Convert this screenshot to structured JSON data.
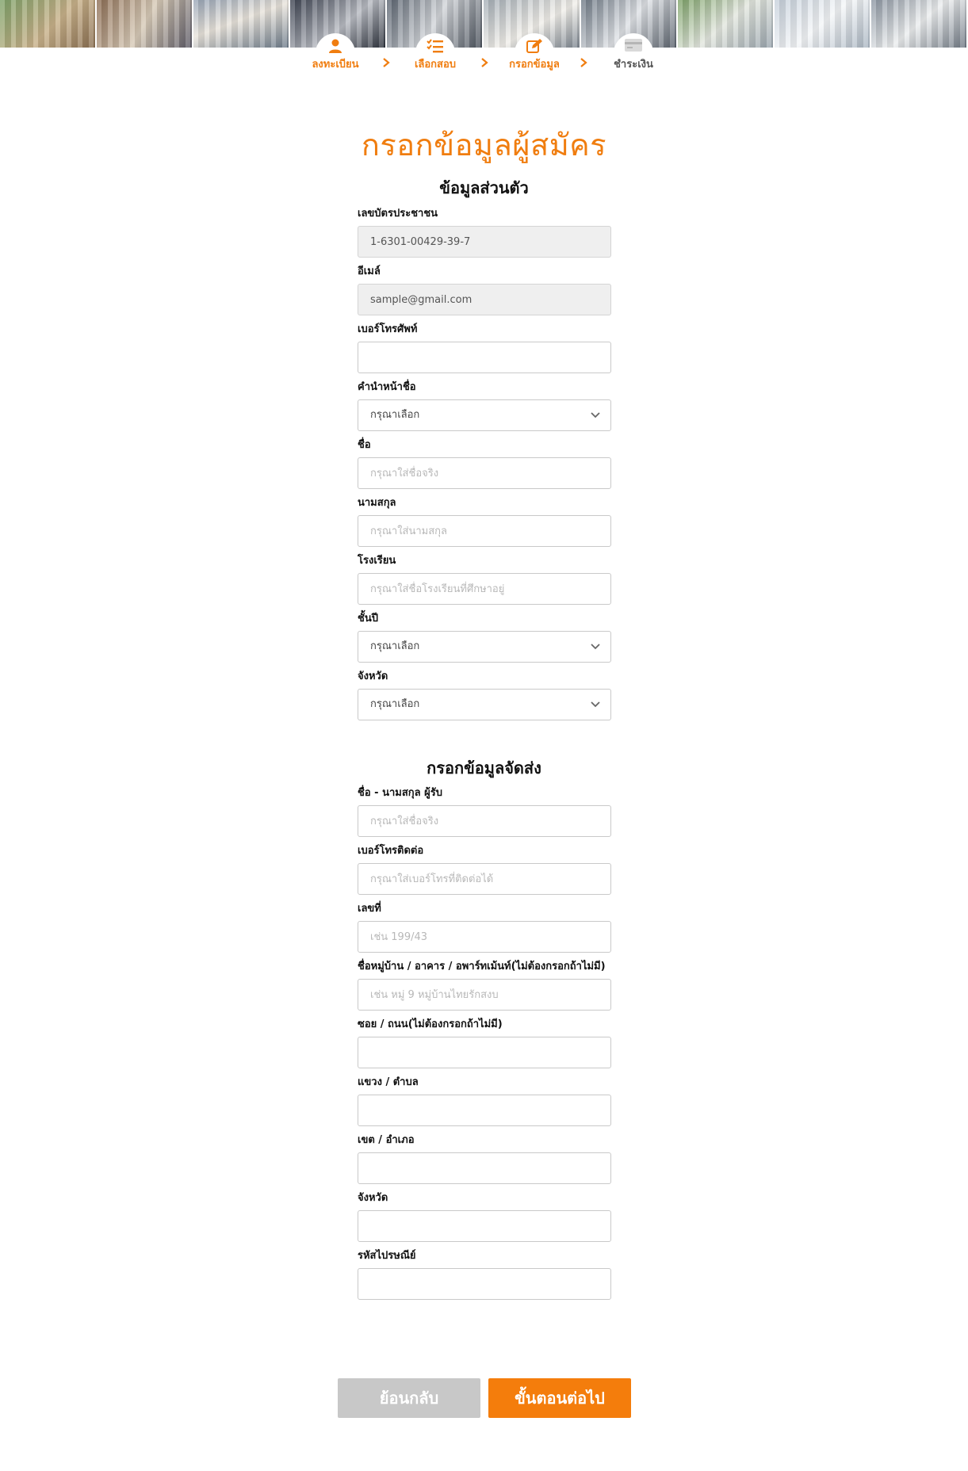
{
  "steps": [
    {
      "label": "ลงทะเบียน",
      "icon": "user-icon",
      "state": "done"
    },
    {
      "label": "เลือกสอบ",
      "icon": "checklist-icon",
      "state": "done"
    },
    {
      "label": "กรอกข้อมูล",
      "icon": "edit-icon",
      "state": "done"
    },
    {
      "label": "ชำระเงิน",
      "icon": "credit-card-icon",
      "state": "pending"
    }
  ],
  "page_title": "กรอกข้อมูลผู้สมัคร",
  "personal": {
    "title": "ข้อมูลส่วนตัว",
    "id_card": {
      "label": "เลขบัตรประชาชน",
      "value": "1-6301-00429-39-7"
    },
    "email": {
      "label": "อีเมล์",
      "value": "sample@gmail.com"
    },
    "phone": {
      "label": "เบอร์โทรศัพท์",
      "value": ""
    },
    "prefix": {
      "label": "คำนำหน้าชื่อ",
      "selected": "กรุณาเลือก"
    },
    "first_name": {
      "label": "ชื่อ",
      "placeholder": "กรุณาใส่ชื่อจริง"
    },
    "last_name": {
      "label": "นามสกุล",
      "placeholder": "กรุณาใส่นามสกุล"
    },
    "school": {
      "label": "โรงเรียน",
      "placeholder": "กรุณาใส่ชื่อโรงเรียนที่ศึกษาอยู่"
    },
    "grade": {
      "label": "ชั้นปี",
      "selected": "กรุณาเลือก"
    },
    "province": {
      "label": "จังหวัด",
      "selected": "กรุณาเลือก"
    }
  },
  "shipping": {
    "title": "กรอกข้อมูลจัดส่ง",
    "recipient": {
      "label": "ชื่อ - นามสกุล ผู้รับ",
      "placeholder": "กรุณาใส่ชื่อจริง"
    },
    "contact_phone": {
      "label": "เบอร์โทรติดต่อ",
      "placeholder": "กรุณาใส่เบอร์โทรที่ติดต่อได้"
    },
    "house_no": {
      "label": "เลขที่",
      "placeholder": "เช่น 199/43"
    },
    "village": {
      "label": "ชื่อหมู่บ้าน / อาคาร / อพาร์ทเม้นท์(ไม่ต้องกรอกถ้าไม่มี)",
      "placeholder": "เช่น หมู่ 9 หมู่บ้านไทยรักสงบ"
    },
    "soi_road": {
      "label": "ซอย / ถนน(ไม่ต้องกรอกถ้าไม่มี)",
      "placeholder": ""
    },
    "subdistrict": {
      "label": "แขวง / ตำบล",
      "placeholder": ""
    },
    "district": {
      "label": "เขต / อำเภอ",
      "placeholder": ""
    },
    "province": {
      "label": "จังหวัด",
      "placeholder": ""
    },
    "postcode": {
      "label": "รหัสไปรษณีย์",
      "placeholder": ""
    }
  },
  "buttons": {
    "back": "ย้อนกลับ",
    "next": "ขั้นตอนต่อไป"
  },
  "colors": {
    "accent": "#f47d0c",
    "disabled": "#c8c8c8",
    "readonly_bg": "#efefef"
  }
}
